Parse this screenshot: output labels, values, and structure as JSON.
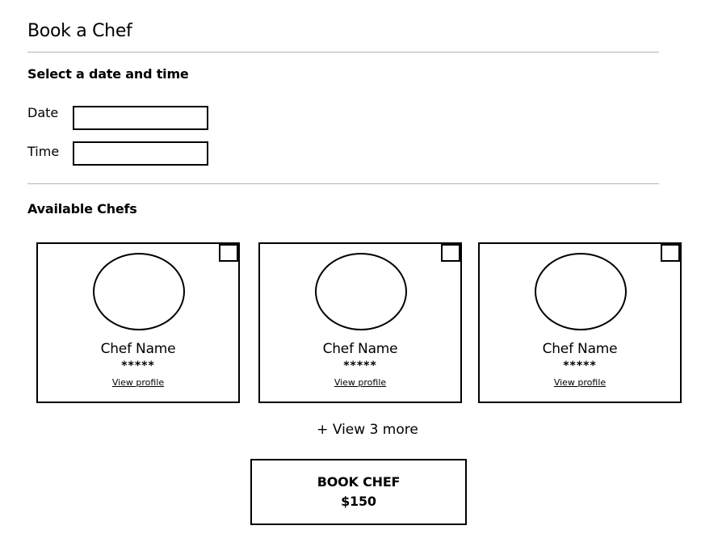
{
  "page": {
    "title": "Book a Chef"
  },
  "datetime": {
    "heading": "Select a date and time",
    "date_label": "Date",
    "date_value": "",
    "time_label": "Time",
    "time_value": ""
  },
  "chefs": {
    "heading": "Available Chefs",
    "items": [
      {
        "name": "Chef Name",
        "rating": "*****",
        "profile_link": "View profile",
        "selected": false
      },
      {
        "name": "Chef Name",
        "rating": "*****",
        "profile_link": "View profile",
        "selected": false
      },
      {
        "name": "Chef Name",
        "rating": "*****",
        "profile_link": "View profile",
        "selected": false
      }
    ],
    "view_more": "+ View 3 more"
  },
  "booking": {
    "button_label": "BOOK CHEF",
    "price": "$150"
  }
}
